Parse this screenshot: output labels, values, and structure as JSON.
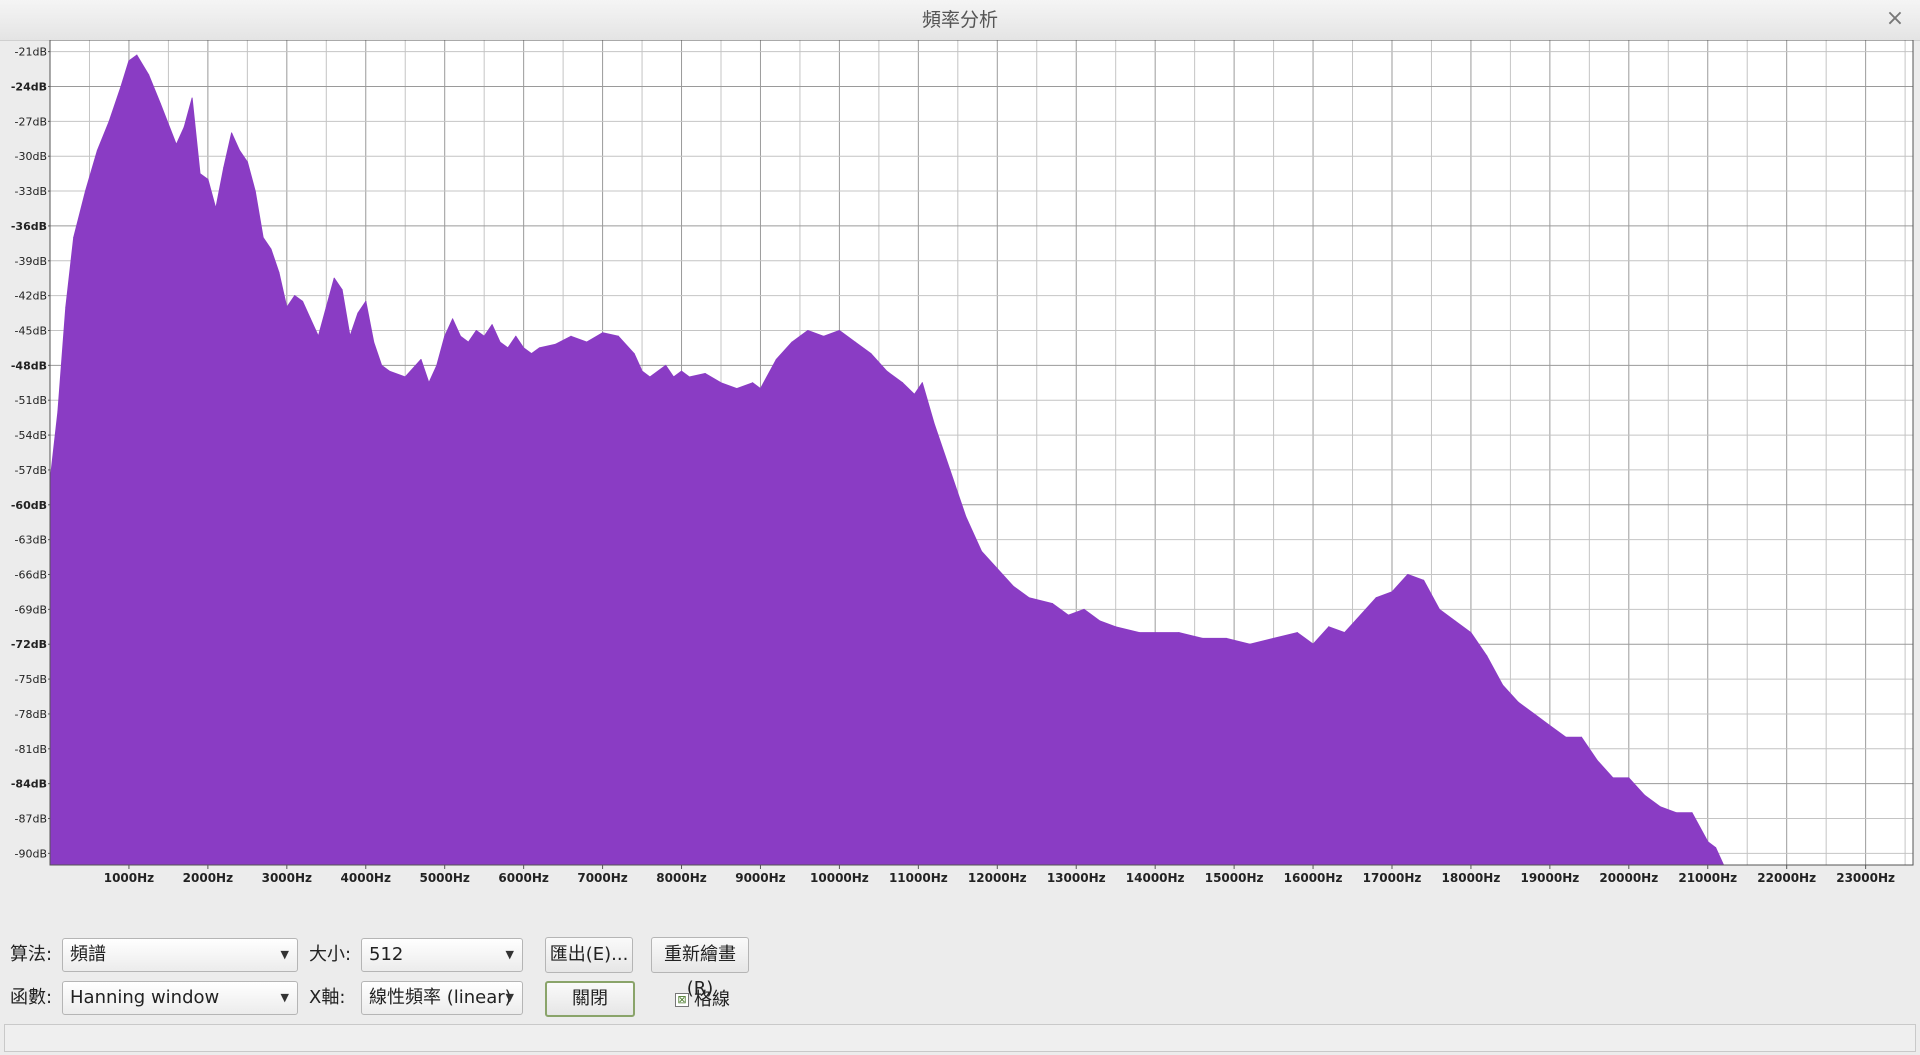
{
  "window": {
    "title": "頻率分析",
    "close_icon": "close-icon",
    "close_glyph": "×"
  },
  "chart_data": {
    "type": "area",
    "xlabel": "",
    "ylabel": "",
    "xlim": [
      0,
      23600
    ],
    "ylim": [
      -91,
      -20
    ],
    "grid": true,
    "fill_color": "#8a3cc4",
    "x_ticks": [
      1000,
      2000,
      3000,
      4000,
      5000,
      6000,
      7000,
      8000,
      9000,
      10000,
      11000,
      12000,
      13000,
      14000,
      15000,
      16000,
      17000,
      18000,
      19000,
      20000,
      21000,
      22000,
      23000
    ],
    "x_tick_labels": [
      "1000Hz",
      "2000Hz",
      "3000Hz",
      "4000Hz",
      "5000Hz",
      "6000Hz",
      "7000Hz",
      "8000Hz",
      "9000Hz",
      "10000Hz",
      "11000Hz",
      "12000Hz",
      "13000Hz",
      "14000Hz",
      "15000Hz",
      "16000Hz",
      "17000Hz",
      "18000Hz",
      "19000Hz",
      "20000Hz",
      "21000Hz",
      "22000Hz",
      "23000Hz"
    ],
    "y_ticks": [
      -21,
      -24,
      -27,
      -30,
      -33,
      -36,
      -39,
      -42,
      -45,
      -48,
      -51,
      -54,
      -57,
      -60,
      -63,
      -66,
      -69,
      -72,
      -75,
      -78,
      -81,
      -84,
      -87,
      -90
    ],
    "y_tick_labels": [
      "-21dB",
      "-24dB",
      "-27dB",
      "-30dB",
      "-33dB",
      "-36dB",
      "-39dB",
      "-42dB",
      "-45dB",
      "-48dB",
      "-51dB",
      "-54dB",
      "-57dB",
      "-60dB",
      "-63dB",
      "-66dB",
      "-69dB",
      "-72dB",
      "-75dB",
      "-78dB",
      "-81dB",
      "-84dB",
      "-87dB",
      "-90dB"
    ],
    "x": [
      0,
      100,
      200,
      300,
      450,
      600,
      750,
      900,
      1000,
      1100,
      1250,
      1400,
      1600,
      1700,
      1800,
      1900,
      2000,
      2100,
      2200,
      2300,
      2400,
      2500,
      2600,
      2700,
      2800,
      2900,
      3000,
      3100,
      3200,
      3300,
      3400,
      3500,
      3600,
      3700,
      3800,
      3900,
      4000,
      4100,
      4200,
      4300,
      4500,
      4700,
      4800,
      4900,
      5000,
      5100,
      5200,
      5300,
      5400,
      5500,
      5600,
      5700,
      5800,
      5900,
      6000,
      6100,
      6200,
      6400,
      6600,
      6800,
      7000,
      7200,
      7400,
      7500,
      7600,
      7800,
      7900,
      8000,
      8100,
      8300,
      8500,
      8700,
      8900,
      9000,
      9200,
      9400,
      9600,
      9800,
      10000,
      10200,
      10400,
      10600,
      10800,
      10950,
      11050,
      11200,
      11400,
      11600,
      11800,
      12000,
      12200,
      12400,
      12700,
      12900,
      13100,
      13300,
      13500,
      13800,
      14000,
      14300,
      14600,
      14900,
      15200,
      15500,
      15800,
      16000,
      16200,
      16400,
      16600,
      16800,
      17000,
      17200,
      17400,
      17600,
      17800,
      18000,
      18200,
      18400,
      18600,
      18800,
      19000,
      19200,
      19400,
      19600,
      19800,
      20000,
      20200,
      20400,
      20600,
      20800,
      21000,
      21100,
      21200
    ],
    "values": [
      -58,
      -52,
      -43,
      -37,
      -33,
      -29.5,
      -27,
      -24,
      -21.8,
      -21.3,
      -23,
      -25.5,
      -29,
      -27.5,
      -25,
      -31.5,
      -32,
      -34.5,
      -31,
      -28,
      -29.5,
      -30.5,
      -33,
      -37,
      -38,
      -40,
      -43,
      -42,
      -42.5,
      -44,
      -45.5,
      -43,
      -40.5,
      -41.5,
      -45.5,
      -43.5,
      -42.5,
      -46,
      -48,
      -48.5,
      -49,
      -47.5,
      -49.5,
      -48,
      -45.5,
      -44,
      -45.5,
      -46,
      -45,
      -45.5,
      -44.5,
      -46,
      -46.5,
      -45.5,
      -46.5,
      -47,
      -46.5,
      -46.2,
      -45.5,
      -46,
      -45.2,
      -45.5,
      -47,
      -48.5,
      -49,
      -48,
      -49,
      -48.5,
      -49,
      -48.7,
      -49.5,
      -50,
      -49.5,
      -50,
      -47.5,
      -46,
      -45,
      -45.5,
      -45,
      -46,
      -47,
      -48.5,
      -49.5,
      -50.5,
      -49.5,
      -53,
      -57,
      -61,
      -64,
      -65.5,
      -67,
      -68,
      -68.5,
      -69.5,
      -69,
      -70,
      -70.5,
      -71,
      -71,
      -71,
      -71.5,
      -71.5,
      -72,
      -71.5,
      -71,
      -72,
      -70.5,
      -71,
      -69.5,
      -68,
      -67.5,
      -66,
      -66.5,
      -69,
      -70,
      -71,
      -73,
      -75.5,
      -77,
      -78,
      -79,
      -80,
      -80,
      -82,
      -83.5,
      -83.5,
      -85,
      -86,
      -86.5,
      -86.5,
      -89,
      -89.5,
      -91
    ]
  },
  "controls": {
    "algorithm_label": "算法:",
    "algorithm_value": "頻譜",
    "size_label": "大小:",
    "size_value": "512",
    "function_label": "函數:",
    "function_value": "Hanning window",
    "xaxis_label": "X軸:",
    "xaxis_value": "線性頻率 (linear)",
    "export_label": "匯出(E)...",
    "replot_label": "重新繪畫(R)",
    "close_label": "關閉",
    "grid_label": "格線",
    "grid_checked": true,
    "check_glyph": "⊠",
    "dropdown_glyph": "▼"
  },
  "status": {
    "text": ""
  }
}
